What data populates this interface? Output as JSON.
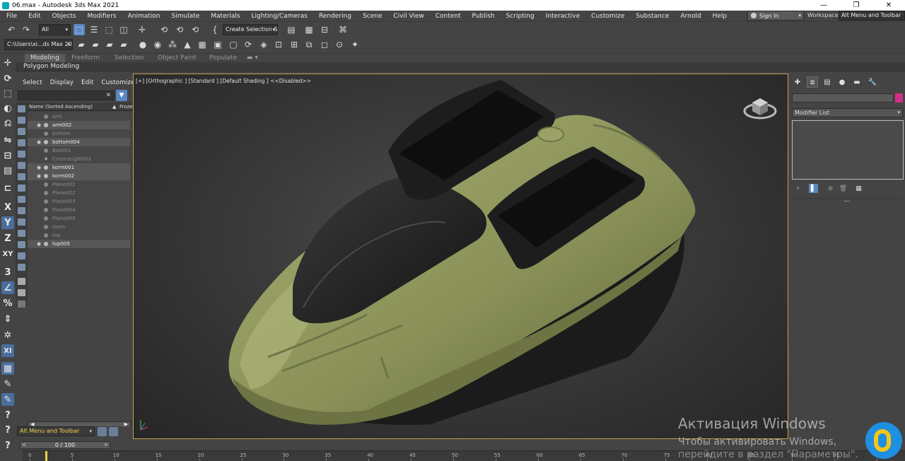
{
  "window": {
    "title": "06.max - Autodesk 3ds Max 2021",
    "minimize": "—",
    "maximize": "❐",
    "close": "✕"
  },
  "menu": [
    "File",
    "Edit",
    "Objects",
    "Modifiers",
    "Animation",
    "Simulate",
    "Materials",
    "Lighting/Cameras",
    "Rendering",
    "Scene",
    "Civil View",
    "Content",
    "Publish",
    "Scripting",
    "Interactive",
    "Customize",
    "Substance",
    "Arnold",
    "Help"
  ],
  "account": {
    "sign_in": "Sign In"
  },
  "workspaces": {
    "label": "Workspaces:",
    "value": "Alt Menu and Toolbar"
  },
  "toolbar": {
    "selection_filter": "All",
    "named_selection": "Create Selection Se",
    "project_path": "C:\\Users\\xi...ds Max 2021"
  },
  "ribbon": {
    "tabs": [
      "Modeling",
      "Freeform",
      "Selection",
      "Object Paint",
      "Populate"
    ],
    "active_tab": "Modeling",
    "panel_label": "Polygon Modeling"
  },
  "explorer": {
    "menu": [
      "Select",
      "Display",
      "Edit",
      "Customize"
    ],
    "search_clear": "✕",
    "column_name": "Name (Sorted Ascending)",
    "sort_arrow": "▲",
    "column_frozen": "Froze",
    "objects": [
      {
        "name": "arm",
        "visible": false,
        "italic": false,
        "kind": "geometry"
      },
      {
        "name": "arm002",
        "visible": true,
        "italic": false,
        "kind": "geometry"
      },
      {
        "name": "bottom",
        "visible": false,
        "italic": false,
        "kind": "geometry"
      },
      {
        "name": "bottom004",
        "visible": true,
        "italic": false,
        "kind": "geometry"
      },
      {
        "name": "Box001",
        "visible": false,
        "italic": false,
        "kind": "geometry"
      },
      {
        "name": "CoronaLight001",
        "visible": false,
        "italic": false,
        "kind": "light"
      },
      {
        "name": "korm001",
        "visible": true,
        "italic": false,
        "kind": "geometry"
      },
      {
        "name": "korm002",
        "visible": true,
        "italic": false,
        "kind": "geometry"
      },
      {
        "name": "Plane001",
        "visible": false,
        "italic": true,
        "kind": "geometry"
      },
      {
        "name": "Plane002",
        "visible": false,
        "italic": true,
        "kind": "geometry"
      },
      {
        "name": "Plane003",
        "visible": false,
        "italic": true,
        "kind": "geometry"
      },
      {
        "name": "Plane004",
        "visible": false,
        "italic": true,
        "kind": "geometry"
      },
      {
        "name": "Plane005",
        "visible": false,
        "italic": true,
        "kind": "geometry"
      },
      {
        "name": "room",
        "visible": false,
        "italic": false,
        "kind": "geometry"
      },
      {
        "name": "top",
        "visible": false,
        "italic": false,
        "kind": "geometry"
      },
      {
        "name": "top005",
        "visible": true,
        "italic": false,
        "kind": "geometry"
      }
    ],
    "eye_glyph": "👁",
    "layer": "Alt Menu and Toolbar"
  },
  "viewport": {
    "label": "[+] [Orthographic ] [Standard ] [Default Shading ]  <<Disabled>>",
    "hull_color": "#8a9258",
    "deck_color": "#1e1e1e"
  },
  "command_panel": {
    "modifier_list": "Modifier List",
    "object_color": "#d02e8a"
  },
  "timeline": {
    "frame_display": "0 / 100",
    "prev": "<",
    "next": ">",
    "ticks": [
      "0",
      "5",
      "10",
      "15",
      "20",
      "25",
      "30",
      "35",
      "40",
      "45",
      "50",
      "55",
      "60",
      "65",
      "70",
      "75",
      "80",
      "85",
      "90",
      "95",
      "100"
    ]
  },
  "activation": {
    "title": "Активация Windows",
    "line1": "Чтобы активировать Windows,",
    "line2": "перейдите в раздел \"Параметры\"."
  },
  "colors": {
    "accent_blue": "#5b87c4",
    "viewport_border": "#c7a04a",
    "timeline_cursor": "#e8d44a"
  }
}
